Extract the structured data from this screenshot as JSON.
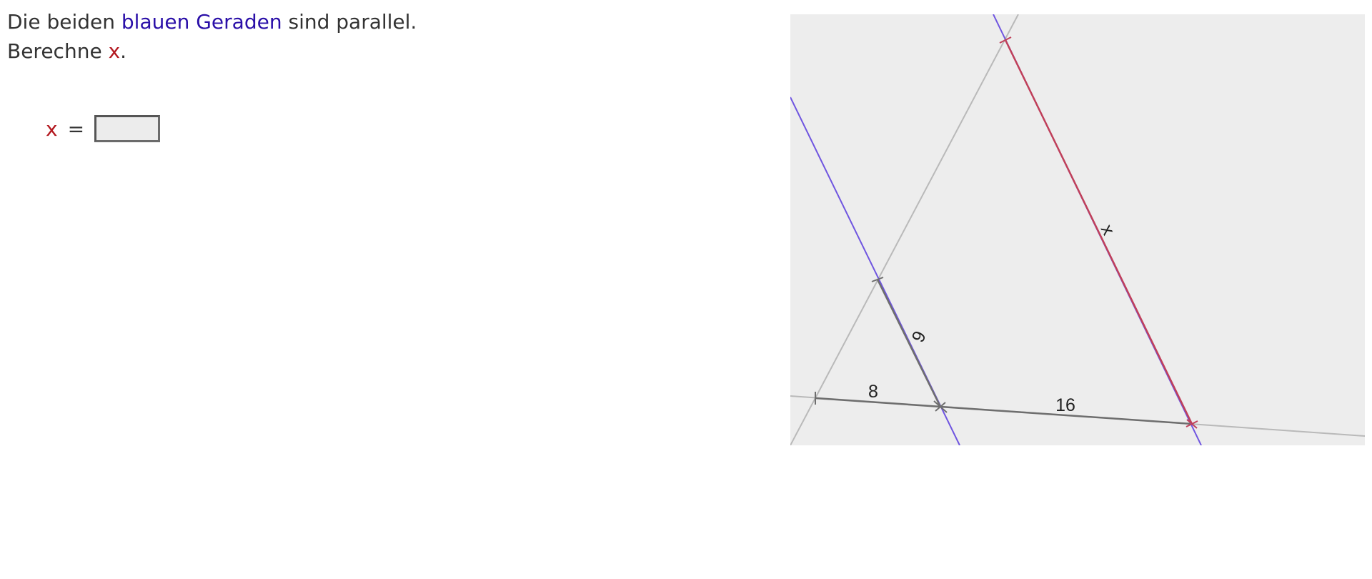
{
  "task": {
    "line1_before": "Die beiden ",
    "line1_highlight": "blauen Geraden",
    "line1_after": " sind parallel.",
    "line2_before": "Berechne ",
    "line2_var": "x",
    "line2_after": "."
  },
  "answer": {
    "variable": "x",
    "equals": "=",
    "value": "",
    "placeholder": ""
  },
  "figure": {
    "label_left_segment": "8",
    "label_right_segment": "16",
    "label_blue_segment": "6",
    "label_red_segment": "x",
    "colors": {
      "blue_line": "#6f55e0",
      "red_line": "#c0405a",
      "gray_line": "#b9b9b9",
      "dark_segment": "#6e6e6e",
      "background": "#ededed"
    }
  }
}
